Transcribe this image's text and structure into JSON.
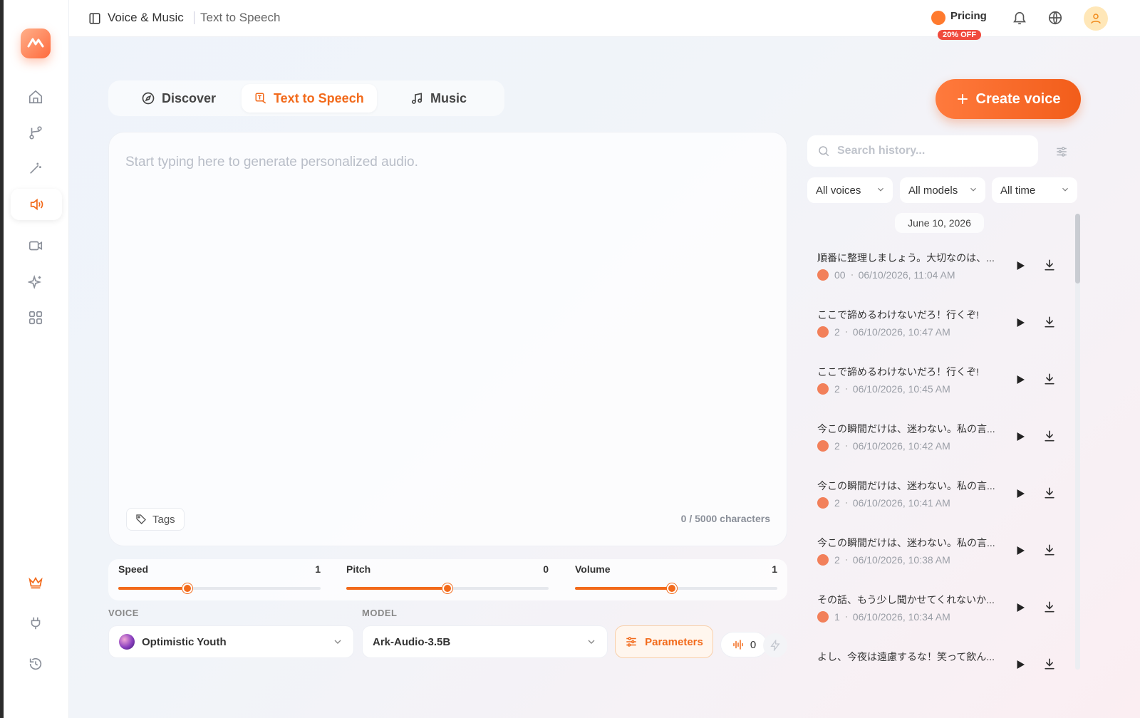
{
  "header": {
    "section": "Voice & Music",
    "page": "Text to Speech",
    "pricing_label": "Pricing",
    "discount_badge": "20% OFF"
  },
  "tabs": [
    {
      "label": "Discover",
      "icon": "compass-icon"
    },
    {
      "label": "Text to Speech",
      "icon": "text-icon"
    },
    {
      "label": "Music",
      "icon": "music-icon"
    }
  ],
  "create_voice_label": "Create voice",
  "editor": {
    "placeholder": "Start typing here to generate personalized audio.",
    "value": "",
    "tags_label": "Tags",
    "char_count": "0 / 5000 characters"
  },
  "sliders": [
    {
      "label": "Speed",
      "value": "1",
      "fraction": 0.34
    },
    {
      "label": "Pitch",
      "value": "0",
      "fraction": 0.5
    },
    {
      "label": "Volume",
      "value": "1",
      "fraction": 0.48
    }
  ],
  "voice": {
    "section_label": "VOICE",
    "selected": "Optimistic Youth"
  },
  "model": {
    "section_label": "MODEL",
    "selected": "Ark-Audio-3.5B"
  },
  "parameters_label": "Parameters",
  "credits": "0",
  "history": {
    "search_placeholder": "Search history...",
    "filters": [
      "All voices",
      "All models",
      "All time"
    ],
    "date_group": "June 10, 2026",
    "items": [
      {
        "text": "順番に整理しましょう。大切なのは、...",
        "count": "00",
        "timestamp": "06/10/2026, 11:04 AM"
      },
      {
        "text": "ここで諦めるわけないだろ！行くぞ!",
        "count": "2",
        "timestamp": "06/10/2026, 10:47 AM"
      },
      {
        "text": "ここで諦めるわけないだろ！行くぞ!",
        "count": "2",
        "timestamp": "06/10/2026, 10:45 AM"
      },
      {
        "text": "今この瞬間だけは、迷わない。私の言...",
        "count": "2",
        "timestamp": "06/10/2026, 10:42 AM"
      },
      {
        "text": "今この瞬間だけは、迷わない。私の言...",
        "count": "2",
        "timestamp": "06/10/2026, 10:41 AM"
      },
      {
        "text": "今この瞬間だけは、迷わない。私の言...",
        "count": "2",
        "timestamp": "06/10/2026, 10:38 AM"
      },
      {
        "text": "その話、もう少し聞かせてくれないか...",
        "count": "1",
        "timestamp": "06/10/2026, 10:34 AM"
      },
      {
        "text": "よし、今夜は遠慮するな！笑って飲ん...",
        "count": "",
        "timestamp": ""
      }
    ]
  },
  "sidebar_icons": [
    "home-icon",
    "branch-icon",
    "magic-wand-icon",
    "speaker-icon",
    "video-icon",
    "sparkle-icon",
    "grid-icon",
    "crown-icon",
    "plug-icon",
    "history-icon"
  ],
  "colors": {
    "accent": "#f26a1b",
    "badge": "#f04a3d"
  }
}
